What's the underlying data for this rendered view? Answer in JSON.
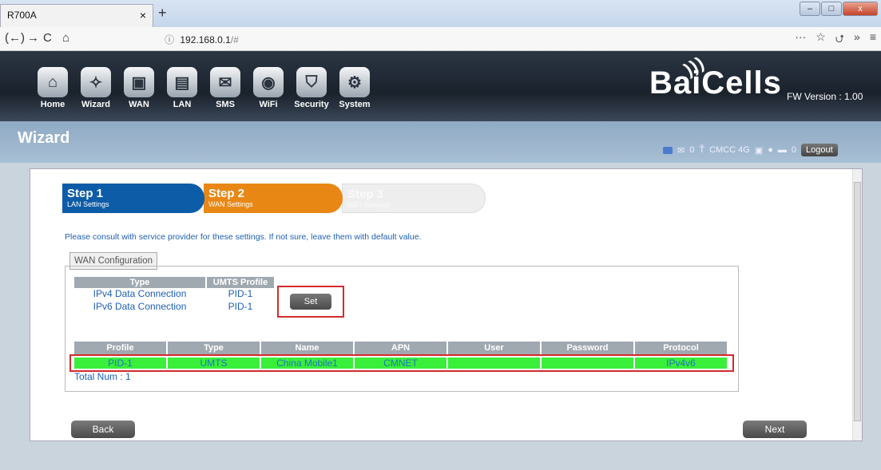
{
  "browser": {
    "tab_title": "R700A",
    "tab_close": "×",
    "new_tab": "+",
    "url_host": "192.168.0.1",
    "url_path": "/#",
    "back": "(←)",
    "forward": "→",
    "reload": "C",
    "home": "⌂",
    "more": "···",
    "star": "☆",
    "library": "⮍",
    "overflow": "»",
    "menu": "≡",
    "win_min": "–",
    "win_max": "□",
    "win_close": "x"
  },
  "app": {
    "menu": [
      "Home",
      "Wizard",
      "WAN",
      "LAN",
      "SMS",
      "WiFi",
      "Security",
      "System"
    ],
    "menu_icons": [
      "home-icon",
      "wizard-icon",
      "wan-icon",
      "lan-icon",
      "sms-icon",
      "wifi-icon",
      "security-icon",
      "system-icon"
    ],
    "brand": "BaiCells",
    "fw_version": "FW Version : 1.00",
    "section_title": "Wizard",
    "status": {
      "sms_count": "0",
      "carrier": "CMCC 4G",
      "clients": "0",
      "logout": "Logout"
    }
  },
  "wizard": {
    "steps": [
      {
        "title": "Step 1",
        "subtitle": "LAN Settings"
      },
      {
        "title": "Step 2",
        "subtitle": "WAN Settings"
      },
      {
        "title": "Step 3",
        "subtitle": "WiFi Settings"
      }
    ],
    "hint": "Please consult with service provider for these settings. If not sure, leave them with default value.",
    "tab_label": "WAN Configuration",
    "connection_table": {
      "headers": [
        "Type",
        "UMTS Profile"
      ],
      "rows": [
        [
          "IPv4 Data Connection",
          "PID-1"
        ],
        [
          "IPv6 Data Connection",
          "PID-1"
        ]
      ]
    },
    "set_button": "Set",
    "profile_table": {
      "headers": [
        "Profile",
        "Type",
        "Name",
        "APN",
        "User",
        "Password",
        "Protocol"
      ],
      "rows": [
        [
          "PID-1",
          "UMTS",
          "China Mobile1",
          "CMNET",
          "",
          "",
          "IPv4v6"
        ]
      ]
    },
    "total": "Total Num : 1",
    "back_button": "Back",
    "next_button": "Next"
  },
  "colors": {
    "step1": "#0d5ca8",
    "step2": "#e98715",
    "row_highlight": "#3aef3a",
    "focus_border": "#d42b2b",
    "link_text": "#1e5fb4"
  }
}
